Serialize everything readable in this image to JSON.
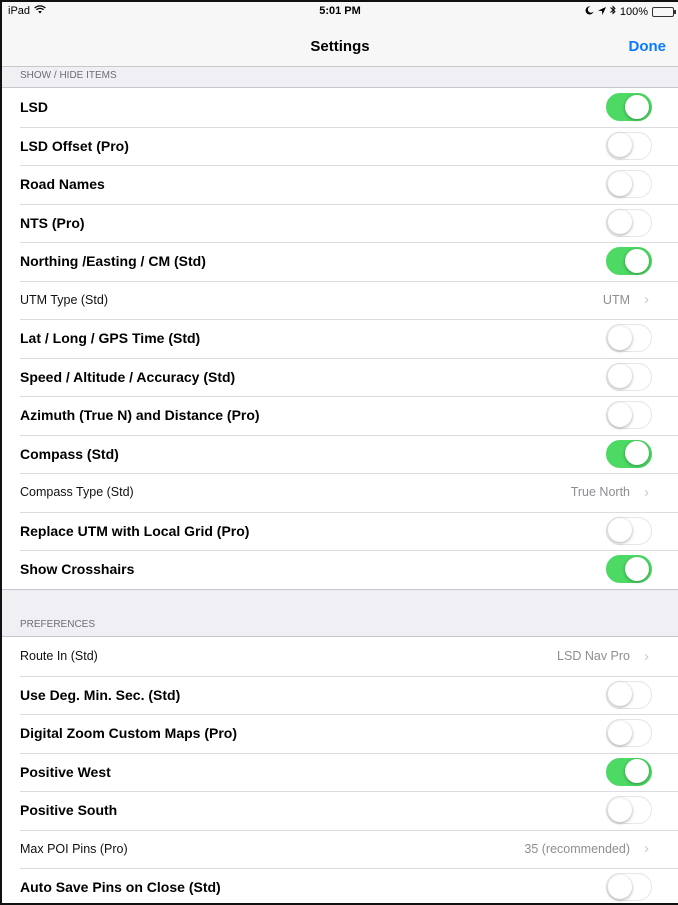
{
  "status_bar": {
    "device": "iPad",
    "time": "5:01 PM",
    "battery": "100%",
    "battery_level": 1.0
  },
  "nav": {
    "title": "Settings",
    "done_label": "Done"
  },
  "sections": [
    {
      "header": "SHOW / HIDE ITEMS",
      "rows": [
        {
          "label": "LSD",
          "style": "bold",
          "type": "toggle",
          "on": true
        },
        {
          "label": "LSD Offset (Pro)",
          "style": "bold",
          "type": "toggle",
          "on": false
        },
        {
          "label": "Road Names",
          "style": "bold",
          "type": "toggle",
          "on": false
        },
        {
          "label": "NTS (Pro)",
          "style": "bold",
          "type": "toggle",
          "on": false
        },
        {
          "label": "Northing /Easting / CM (Std)",
          "style": "bold",
          "type": "toggle",
          "on": true
        },
        {
          "label": "UTM Type (Std)",
          "style": "light",
          "type": "disclosure",
          "value": "UTM"
        },
        {
          "label": "Lat / Long / GPS Time (Std)",
          "style": "bold",
          "type": "toggle",
          "on": false
        },
        {
          "label": "Speed / Altitude / Accuracy (Std)",
          "style": "bold",
          "type": "toggle",
          "on": false
        },
        {
          "label": "Azimuth (True N) and Distance (Pro)",
          "style": "bold",
          "type": "toggle",
          "on": false
        },
        {
          "label": "Compass (Std)",
          "style": "bold",
          "type": "toggle",
          "on": true
        },
        {
          "label": "Compass Type (Std)",
          "style": "light",
          "type": "disclosure",
          "value": "True North"
        },
        {
          "label": "Replace UTM with Local Grid (Pro)",
          "style": "bold",
          "type": "toggle",
          "on": false
        },
        {
          "label": "Show Crosshairs",
          "style": "bold",
          "type": "toggle",
          "on": true
        }
      ]
    },
    {
      "header": "PREFERENCES",
      "rows": [
        {
          "label": "Route In (Std)",
          "style": "light",
          "type": "disclosure",
          "value": "LSD Nav Pro"
        },
        {
          "label": "Use Deg. Min. Sec. (Std)",
          "style": "bold",
          "type": "toggle",
          "on": false
        },
        {
          "label": "Digital Zoom Custom Maps (Pro)",
          "style": "bold",
          "type": "toggle",
          "on": false
        },
        {
          "label": "Positive West",
          "style": "bold",
          "type": "toggle",
          "on": true
        },
        {
          "label": "Positive South",
          "style": "bold",
          "type": "toggle",
          "on": false
        },
        {
          "label": "Max POI Pins (Pro)",
          "style": "light",
          "type": "disclosure",
          "value": "35 (recommended)"
        },
        {
          "label": "Auto Save Pins on Close (Std)",
          "style": "bold",
          "type": "toggle",
          "on": false
        }
      ]
    }
  ]
}
